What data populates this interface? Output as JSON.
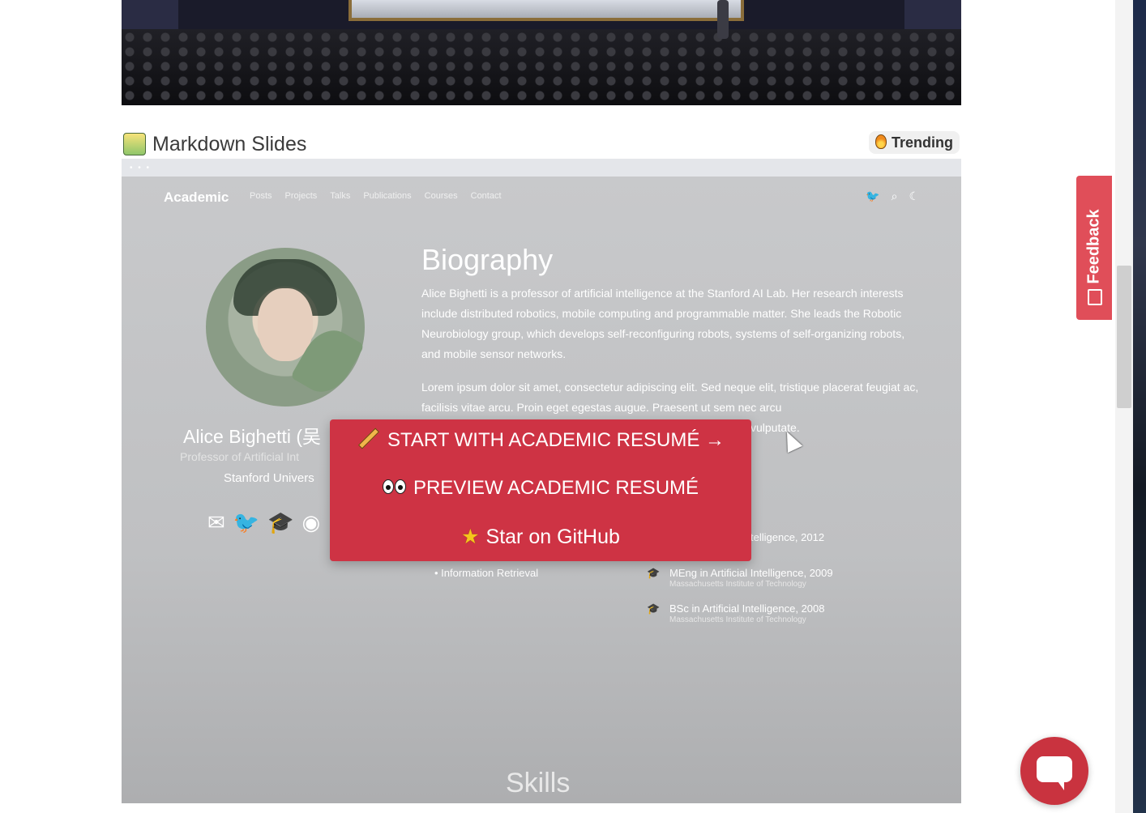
{
  "section": {
    "title": "Markdown Slides",
    "badge": "Trending"
  },
  "preview": {
    "brand": "Academic",
    "nav": [
      "Posts",
      "Projects",
      "Talks",
      "Publications",
      "Courses",
      "Contact"
    ],
    "profile": {
      "name": "Alice Bighetti (吴",
      "role": "Professor of Artificial Int",
      "university": "Stanford Univers"
    },
    "bio": {
      "title": "Biography",
      "p1": "Alice Bighetti is a professor of artificial intelligence at the Stanford AI Lab. Her research interests include distributed robotics, mobile computing and programmable matter. She leads the Robotic Neurobiology group, which develops self-reconfiguring robots, systems of self-organizing robots, and mobile sensor networks.",
      "p2": "Lorem ipsum dolor sit amet, consectetur adipiscing elit. Sed neque elit, tristique placerat feugiat ac, facilisis vitae arcu. Proin eget egestas augue. Praesent ut sem nec arcu",
      "p2_tail": "vulputate."
    },
    "interest_item": "Information Retrieval",
    "education": [
      {
        "degree": "telligence, 2012",
        "school": ""
      },
      {
        "degree": "MEng in Artificial Intelligence, 2009",
        "school": "Massachusetts Institute of Technology"
      },
      {
        "degree": "BSc in Artificial Intelligence, 2008",
        "school": "Massachusetts Institute of Technology"
      }
    ],
    "skills_heading": "Skills"
  },
  "cta": {
    "start": "START WITH ACADEMIC RESUMÉ →",
    "preview": "PREVIEW ACADEMIC RESUMÉ",
    "star": "Star on GitHub"
  },
  "feedback_label": "Feedback",
  "colors": {
    "cta": "#ce3344",
    "feedback": "#e04e59",
    "chat": "#c9333f"
  }
}
